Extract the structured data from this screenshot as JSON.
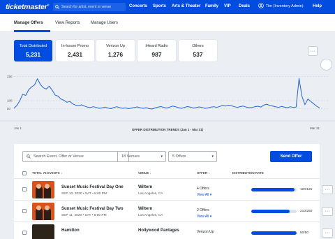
{
  "nav": {
    "logo": "ticketmaster",
    "search_placeholder": "Search for artist, event or venue",
    "links": [
      "Concerts",
      "Sports",
      "Arts & Theater",
      "Family",
      "VIP",
      "Deals"
    ],
    "user": "Tim (Inventory Admin)",
    "help": "Help"
  },
  "tabs": [
    "Manage Offers",
    "View Reports",
    "Manage Users"
  ],
  "stats": [
    {
      "label": "Total Distributed",
      "value": "5,231"
    },
    {
      "label": "In-house Promo",
      "value": "2,431"
    },
    {
      "label": "Verizon Up",
      "value": "1,276"
    },
    {
      "label": "iHeard Radio",
      "value": "987"
    },
    {
      "label": "Others",
      "value": "537"
    }
  ],
  "chart_data": {
    "type": "line",
    "title": "OFFER DISTRIBUTION TRENDS (Jan 1 - Mar 31)",
    "x_start_label": "Jan 1",
    "x_end_label": "Mar 31",
    "ylim": [
      0,
      300
    ],
    "yticks": [
      "250",
      "100",
      "50"
    ],
    "line_color": "#1f63d8",
    "values": [
      52,
      70,
      100,
      140,
      132,
      168,
      185,
      198,
      236,
      200,
      180,
      172,
      190,
      165,
      135,
      128,
      110,
      102,
      90,
      95,
      80,
      72,
      68,
      74,
      66,
      60,
      57,
      62,
      58,
      52,
      55,
      60,
      54,
      50,
      58,
      62,
      56,
      52,
      55,
      50,
      54,
      58,
      61,
      55,
      52,
      56,
      50,
      48,
      55,
      60,
      63,
      58,
      54,
      60,
      66,
      62,
      56,
      52,
      58,
      63,
      60,
      54,
      57,
      61,
      58,
      52,
      55,
      60,
      62,
      58,
      64,
      70,
      66,
      72,
      68,
      62,
      58,
      63,
      66,
      60,
      56,
      58,
      62,
      65,
      60,
      72,
      78,
      70,
      66,
      62,
      58,
      64,
      60,
      56,
      62,
      58,
      60,
      238,
      126,
      75,
      110,
      95,
      80,
      65,
      55
    ]
  },
  "filters": {
    "search_placeholder": "Search Event, Offer or Venue",
    "venues": "18 Venues",
    "offers": "5 Offers",
    "send_label": "Send Offer"
  },
  "table": {
    "headers": [
      "TOTAL 75 EVENTS",
      "VENUE",
      "OFFER",
      "DISTRIBUTION RATE"
    ],
    "rows": [
      {
        "event": "Sunset Music Festival Day One",
        "date": "SEP 10, 2020 • SAT • 8:00 PM",
        "venue": "Wiltern",
        "city": "Los Angeles, CA",
        "offers": "4 Offers",
        "view": "View All",
        "rate": 0.96,
        "rate_label": "120/125"
      },
      {
        "event": "Sunset Music Festival Day Two",
        "date": "SEP 11, 2020 • SAT • 8:00 PM",
        "venue": "Wiltern",
        "city": "Los Angeles, CA",
        "offers": "2 Offers",
        "view": "View All",
        "rate": 0.84,
        "rate_label": "210/250"
      },
      {
        "event": "Hamilton",
        "date": "",
        "venue": "Hollywood Pantages",
        "city": "",
        "offers": "Verizon Up",
        "view": "",
        "rate": 1.0,
        "rate_label": "50/50"
      }
    ]
  }
}
